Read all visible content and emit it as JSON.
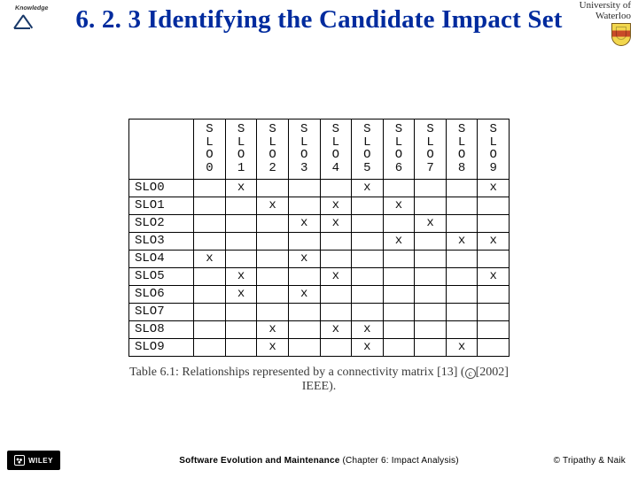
{
  "header": {
    "title": "6. 2. 3 Identifying the Candidate Impact Set",
    "left_logo_label": "Knowledge",
    "right_logo_univ_top": "University of",
    "right_logo_univ_name": "Waterloo"
  },
  "chart_data": {
    "type": "table",
    "title": "Relationships represented by a connectivity matrix",
    "columns": [
      "SLO0",
      "SLO1",
      "SLO2",
      "SLO3",
      "SLO4",
      "SLO5",
      "SLO6",
      "SLO7",
      "SLO8",
      "SLO9"
    ],
    "rows": [
      "SLO0",
      "SLO1",
      "SLO2",
      "SLO3",
      "SLO4",
      "SLO5",
      "SLO6",
      "SLO7",
      "SLO8",
      "SLO9"
    ],
    "mark": "x",
    "matrix": [
      [
        0,
        1,
        0,
        0,
        0,
        1,
        0,
        0,
        0,
        1
      ],
      [
        0,
        0,
        1,
        0,
        1,
        0,
        1,
        0,
        0,
        0
      ],
      [
        0,
        0,
        0,
        1,
        1,
        0,
        0,
        1,
        0,
        0
      ],
      [
        0,
        0,
        0,
        0,
        0,
        0,
        1,
        0,
        1,
        1
      ],
      [
        1,
        0,
        0,
        1,
        0,
        0,
        0,
        0,
        0,
        0
      ],
      [
        0,
        1,
        0,
        0,
        1,
        0,
        0,
        0,
        0,
        1
      ],
      [
        0,
        1,
        0,
        1,
        0,
        0,
        0,
        0,
        0,
        0
      ],
      [
        0,
        0,
        0,
        0,
        0,
        0,
        0,
        0,
        0,
        0
      ],
      [
        0,
        0,
        1,
        0,
        1,
        1,
        0,
        0,
        0,
        0
      ],
      [
        0,
        0,
        1,
        0,
        0,
        1,
        0,
        0,
        1,
        0
      ]
    ]
  },
  "caption": {
    "prefix": "Table 6.1: Relationships represented by a connectivity matrix ",
    "ref": "[13]",
    "after_ref_open": " (",
    "copy_symbol": "c",
    "after_copy": "[2002] IEEE)."
  },
  "footer": {
    "publisher": "WILEY",
    "book": "Software Evolution and Maintenance",
    "chapter": "  (Chapter 6: Impact Analysis)",
    "copyright": "© Tripathy & Naik"
  }
}
